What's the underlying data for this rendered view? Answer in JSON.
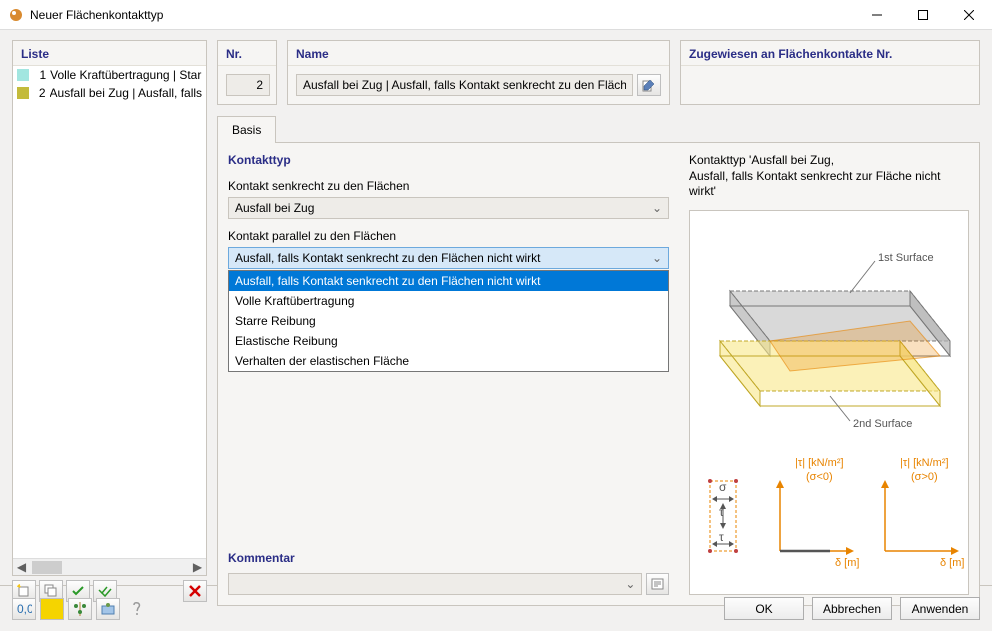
{
  "window_title": "Neuer Flächenkontakttyp",
  "list": {
    "header": "Liste",
    "items": [
      {
        "num": "1",
        "name": "Volle Kraftübertragung | Starre",
        "color": "#a2e6e0"
      },
      {
        "num": "2",
        "name": "Ausfall bei Zug | Ausfall, falls Ko",
        "color": "#c3bb3c"
      }
    ]
  },
  "nr": {
    "header": "Nr.",
    "value": "2"
  },
  "name": {
    "header": "Name",
    "value": "Ausfall bei Zug | Ausfall, falls Kontakt senkrecht zu den Flächen"
  },
  "zug": {
    "header": "Zugewiesen an Flächenkontakte Nr."
  },
  "tab_basis": "Basis",
  "section_kontakttyp": "Kontakttyp",
  "label_senkrecht": "Kontakt senkrecht zu den Flächen",
  "value_senkrecht": "Ausfall bei Zug",
  "label_parallel": "Kontakt parallel zu den Flächen",
  "value_parallel": "Ausfall, falls Kontakt senkrecht zu den Flächen nicht wirkt",
  "dropdown_options": [
    "Ausfall, falls Kontakt senkrecht zu den Flächen nicht wirkt",
    "Volle Kraftübertragung",
    "Starre Reibung",
    "Elastische Reibung",
    "Verhalten der elastischen Fläche"
  ],
  "kommentar_label": "Kommentar",
  "preview_line1": "Kontakttyp 'Ausfall bei Zug,",
  "preview_line2": "Ausfall, falls Kontakt senkrecht zur Fläche nicht wirkt'",
  "surf1": "1st Surface",
  "surf2": "2nd Surface",
  "tau1_label": "|τ| [kN/m²]",
  "tau1_sub": "(σ<0)",
  "tau2_label": "|τ| [kN/m²]",
  "tau2_sub": "(σ>0)",
  "delta_label": "δ [m]",
  "btn_ok": "OK",
  "btn_cancel": "Abbrechen",
  "btn_apply": "Anwenden"
}
